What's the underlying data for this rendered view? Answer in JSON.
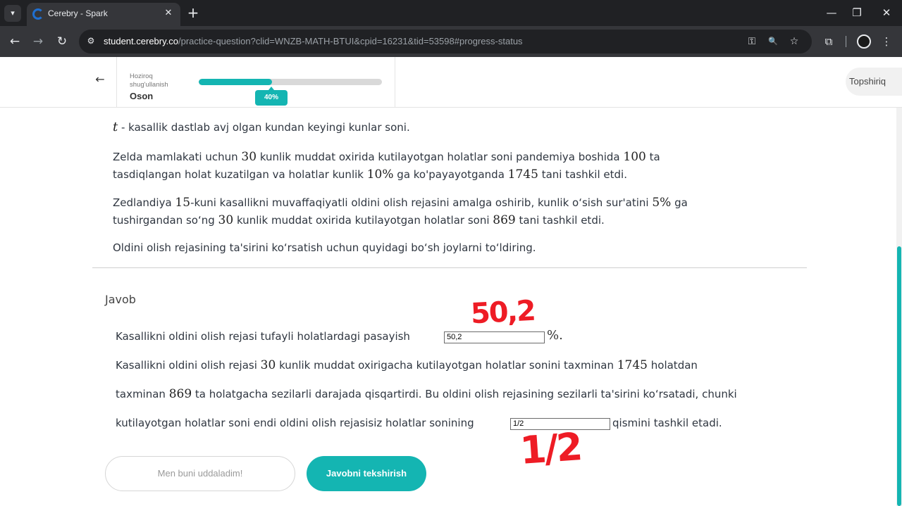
{
  "browser": {
    "tab_title": "Cerebry - Spark",
    "url_host": "student.cerebry.co",
    "url_path": "/practice-question?clid=WNZB-MATH-BTUI&cpid=16231&tid=53598#progress-status",
    "icons": {
      "menu": "▾",
      "close": "✕",
      "new_tab": "+",
      "minimize": "—",
      "restore": "❐",
      "window_close": "✕",
      "back": "←",
      "forward": "→",
      "reload": "↻",
      "site_info": "⚙",
      "key": "⚿",
      "zoom": "🔍",
      "star": "☆",
      "extensions": "⧉",
      "more": "⋮"
    }
  },
  "header": {
    "back_icon": "←",
    "label_line1": "Hoziroq",
    "label_line2": "shug'ullanish",
    "level": "Oson",
    "progress_fraction": 0.4,
    "progress_label": "40%",
    "topshiriq": "Topshiriq"
  },
  "problem": {
    "p0": {
      "var": "t",
      "text": " - kasallik dastlab avj olgan kundan keyingi kunlar soni."
    },
    "p1": {
      "a": "Zelda mamlakati uchun ",
      "n1": "30",
      "b": " kunlik muddat oxirida kutilayotgan holatlar soni pandemiya boshida ",
      "n2": "100",
      "c": " ta",
      "d": "tasdiqlangan holat kuzatilgan va holatlar kunlik ",
      "n3": "10%",
      "e": " ga ko'payayotganda ",
      "n4": "1745",
      "f": " tani tashkil etdi."
    },
    "p2": {
      "a": "Zedlandiya ",
      "n1": "15",
      "b": "-kuni kasallikni muvaffaqiyatli oldini olish rejasini amalga oshirib, kunlik o‘sish sur'atini ",
      "n2": "5%",
      "c": " ga",
      "d": "tushirgandan so‘ng ",
      "n3": "30",
      "e": " kunlik muddat oxirida kutilayotgan holatlar soni ",
      "n4": "869",
      "f": " tani tashkil etdi."
    },
    "p3": "Oldini olish rejasining ta'sirini ko‘rsatish uchun quyidagi bo‘sh joylarni to‘ldiring."
  },
  "answer": {
    "heading": "Javob",
    "line1": "Kasallikni oldini olish rejasi tufayli holatlardagi pasayish",
    "input1_value": "50,2",
    "pct_sign": "%.",
    "line2": {
      "a": "Kasallikni oldini olish rejasi ",
      "n1": "30",
      "b": " kunlik muddat oxirigacha kutilayotgan holatlar sonini taxminan ",
      "n2": "1745",
      "c": " holatdan"
    },
    "line3": {
      "a": "taxminan ",
      "n1": "869",
      "b": " ta holatgacha sezilarli darajada qisqartirdi. Bu oldini olish rejasining sezilarli ta'sirini ko‘rsatadi, chunki"
    },
    "line4": "kutilayotgan holatlar soni endi oldini olish rejasisiz holatlar sonining",
    "input2_value": "1/2",
    "line4_after": "qismini tashkil etadi.",
    "handwriting1": "50,2",
    "handwriting2": "1/2"
  },
  "buttons": {
    "skip": "Men buni uddaladim!",
    "check": "Javobni tekshirish"
  },
  "colors": {
    "accent": "#14b5b2",
    "annotation": "#ee1c25"
  }
}
